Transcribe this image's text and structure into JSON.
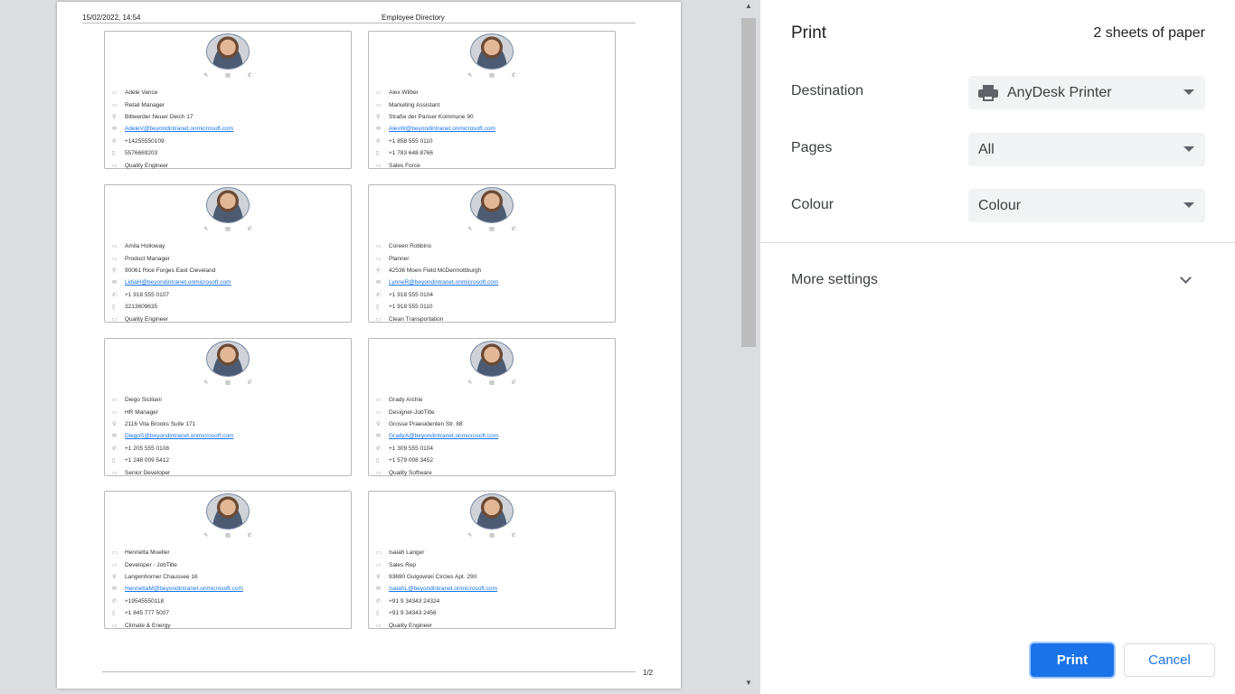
{
  "preview": {
    "header_date": "15/02/2022, 14:54",
    "header_title": "Employee Directory",
    "page_number": "1/2",
    "card_icons": [
      "✎",
      "▤",
      "✆"
    ],
    "row_icons": [
      "▭",
      "▭",
      "⚲",
      "✉",
      "✆",
      "▯",
      "▭"
    ],
    "cards": [
      {
        "name": "Adele Vance",
        "title": "Retail Manager",
        "address": "Billwerder Neuer Deich 17",
        "email": "AdeleV@beyondintranet.onmicrosoft.com",
        "phone": "+14255550109",
        "mobile": "5576669203",
        "dept": "Quality Engineer"
      },
      {
        "name": "Alex Wilber",
        "title": "Marketing Assistant",
        "address": "Straße der Pariser Kommune 90",
        "email": "AlexW@beyondintranet.onmicrosoft.com",
        "phone": "+1 858 555 0110",
        "mobile": "+1 783 648 8766",
        "dept": "Sales Force"
      },
      {
        "name": "Amila Holloway",
        "title": "Product Manager",
        "address": "90061 Rice Forges East Cleveland",
        "email": "LidiaH@beyondintranet.onmicrosoft.com",
        "phone": "+1 918 555 0107",
        "mobile": "3213609635",
        "dept": "Quality Engineer"
      },
      {
        "name": "Coreen Robbins",
        "title": "Planner",
        "address": "42536 Moen Field McDermottburgh",
        "email": "LynneR@beyondintranet.onmicrosoft.com",
        "phone": "+1 918 555 0104",
        "mobile": "+1 918 555 0110",
        "dept": "Clean Transportation"
      },
      {
        "name": "Diego Siciliani",
        "title": "HR Manager",
        "address": "2116 Vita Brooks Suite 171",
        "email": "DiegoS@beyondintranet.onmicrosoft.com",
        "phone": "+1 205 555 0108",
        "mobile": "+1 248 009 5412",
        "dept": "Senior Developer"
      },
      {
        "name": "Grady Archie",
        "title": "Designer-JobTitle",
        "address": "Grosse Praesidenten Str. 88",
        "email": "GradyA@beyondintranet.onmicrosoft.com",
        "phone": "+1 309 555 0104",
        "mobile": "+1 579 008 3452",
        "dept": "Quality Software"
      },
      {
        "name": "Henrietta Mueller",
        "title": "Developer - JobTitle",
        "address": "Langenhorner Chaussee 16",
        "email": "HenriettaM@beyondintranet.onmicrosoft.com",
        "phone": "+19545550118",
        "mobile": "+1 845 777 5007",
        "dept": "Climate & Energy"
      },
      {
        "name": "Isaiah Langer",
        "title": "Sales Rep",
        "address": "93690 Gulgowski Circles Apt. 290",
        "email": "IsaiahL@beyondintranet.onmicrosoft.com",
        "phone": "+91 9 34343 24324",
        "mobile": "+91 9 34343 2456",
        "dept": "Quality Engineer"
      }
    ]
  },
  "scrollbar": {
    "up": "▲",
    "down": "▼"
  },
  "settings": {
    "title": "Print",
    "sheets": "2 sheets of paper",
    "destination_label": "Destination",
    "destination_value": "AnyDesk Printer",
    "pages_label": "Pages",
    "pages_value": "All",
    "colour_label": "Colour",
    "colour_value": "Colour",
    "more_settings": "More settings",
    "print_button": "Print",
    "cancel_button": "Cancel"
  },
  "colors": {
    "accent": "#1a73e8",
    "select_bg": "#f1f3f4",
    "panel_bg": "#dcdde0"
  }
}
